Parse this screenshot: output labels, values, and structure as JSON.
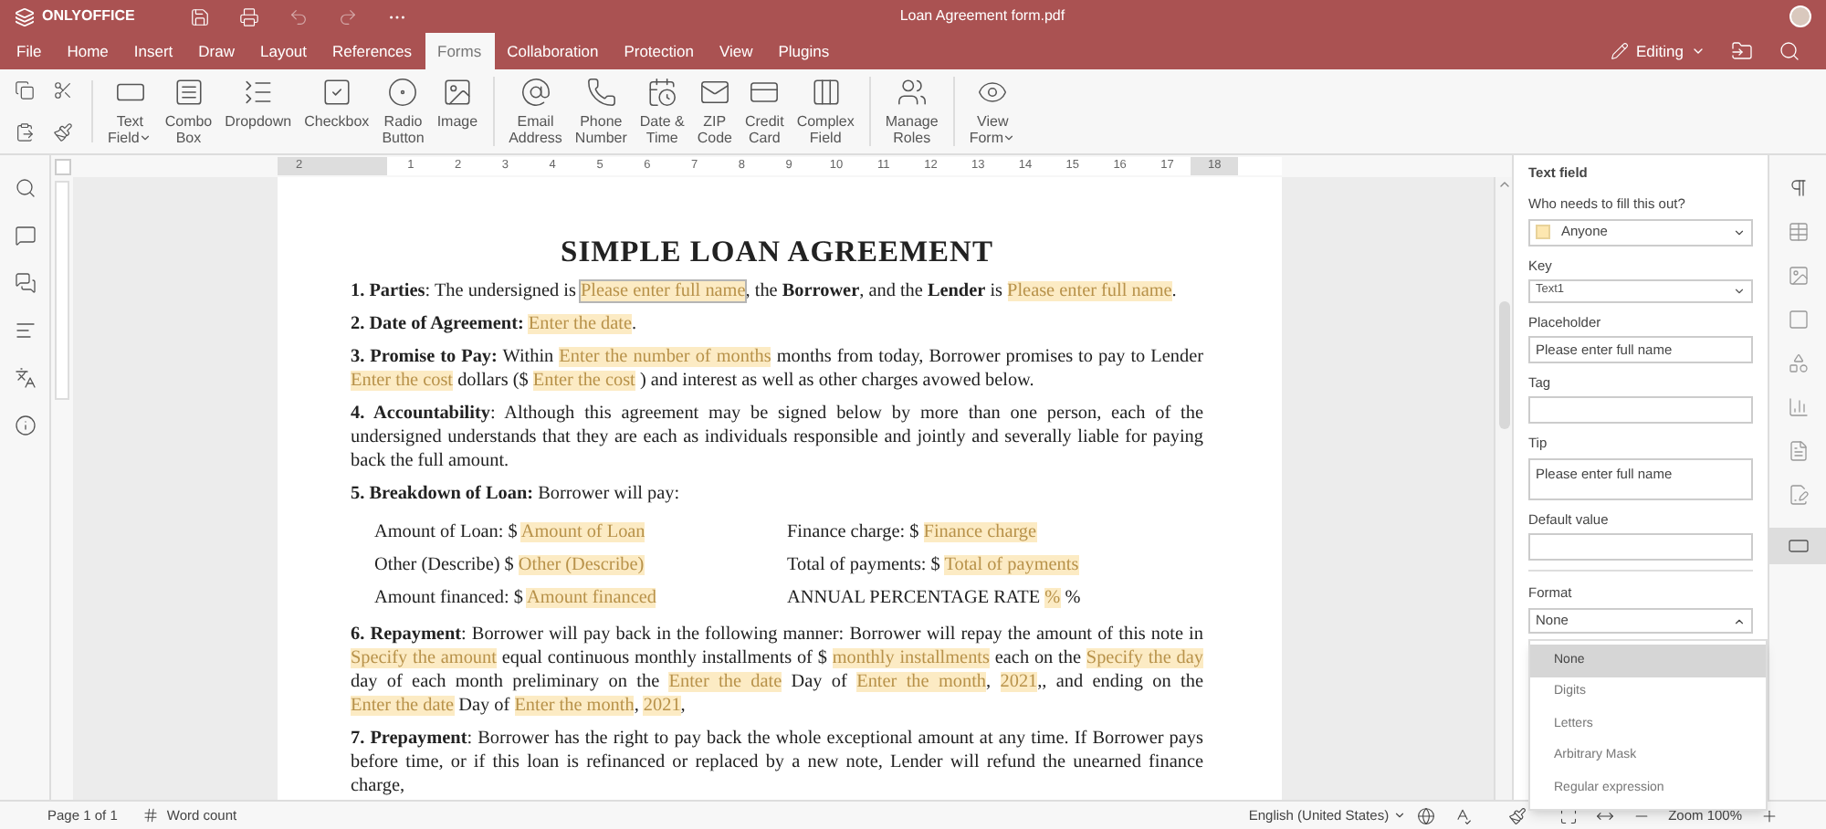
{
  "app": {
    "logo": "ONLYOFFICE",
    "title": "Loan Agreement form.pdf",
    "mode": "Editing"
  },
  "menu": [
    {
      "label": "File",
      "selected": false
    },
    {
      "label": "Home",
      "selected": false
    },
    {
      "label": "Insert",
      "selected": false
    },
    {
      "label": "Draw",
      "selected": false
    },
    {
      "label": "Layout",
      "selected": false
    },
    {
      "label": "References",
      "selected": false
    },
    {
      "label": "Forms",
      "selected": true
    },
    {
      "label": "Collaboration",
      "selected": false
    },
    {
      "label": "Protection",
      "selected": false
    },
    {
      "label": "View",
      "selected": false
    },
    {
      "label": "Plugins",
      "selected": false
    }
  ],
  "toolbar": [
    [
      {
        "kind": "text_field",
        "lines": [
          "Text",
          "Field"
        ],
        "menu": true
      },
      {
        "kind": "combo_box",
        "lines": [
          "Combo",
          "Box"
        ],
        "menu": false
      },
      {
        "kind": "dropdown",
        "lines": [
          "Dropdown"
        ],
        "menu": false
      },
      {
        "kind": "checkbox",
        "lines": [
          "Checkbox"
        ],
        "menu": false
      },
      {
        "kind": "radio",
        "lines": [
          "Radio",
          "Button"
        ],
        "menu": false
      },
      {
        "kind": "image",
        "lines": [
          "Image"
        ],
        "menu": false
      }
    ],
    [
      {
        "kind": "email",
        "lines": [
          "Email",
          "Address"
        ],
        "menu": false
      },
      {
        "kind": "phone",
        "lines": [
          "Phone",
          "Number"
        ],
        "menu": false
      },
      {
        "kind": "datetime",
        "lines": [
          "Date &",
          "Time"
        ],
        "menu": false
      },
      {
        "kind": "zip",
        "lines": [
          "ZIP",
          "Code"
        ],
        "menu": false
      },
      {
        "kind": "card",
        "lines": [
          "Credit",
          "Card"
        ],
        "menu": false
      },
      {
        "kind": "complex",
        "lines": [
          "Complex",
          "Field"
        ],
        "menu": false
      }
    ],
    [
      {
        "kind": "roles",
        "lines": [
          "Manage",
          "Roles"
        ],
        "menu": false
      }
    ],
    [
      {
        "kind": "view",
        "lines": [
          "View",
          "Form"
        ],
        "menu": true
      }
    ]
  ],
  "ruler": {
    "left_label": "2",
    "labels": [
      "1",
      "2",
      "3",
      "4",
      "5",
      "6",
      "7",
      "8",
      "9",
      "10",
      "11",
      "12",
      "13",
      "14",
      "15",
      "16",
      "17",
      "18"
    ]
  },
  "document": {
    "title": "SIMPLE LOAN AGREEMENT",
    "paragraphs": [
      {
        "segments": [
          {
            "kind": "text",
            "text": "**1. Parties**: The undersigned is "
          },
          {
            "kind": "field",
            "text": "Please enter full name",
            "selected": true
          },
          {
            "kind": "text",
            "text": ", the **Borrower**, and the **Lender** is "
          },
          {
            "kind": "field",
            "text": "Please enter full name",
            "selected": false
          },
          {
            "kind": "text",
            "text": "."
          }
        ]
      },
      {
        "segments": [
          {
            "kind": "text",
            "text": "**2. Date of Agreement:** "
          },
          {
            "kind": "field",
            "text": "Enter the date",
            "selected": false
          },
          {
            "kind": "text",
            "text": "."
          }
        ]
      },
      {
        "segments": [
          {
            "kind": "text",
            "text": "**3. Promise to Pay:** Within "
          },
          {
            "kind": "field",
            "text": "Enter the number of months",
            "selected": false
          },
          {
            "kind": "text",
            "text": " months from today, Borrower promises to pay to Lender "
          },
          {
            "kind": "field",
            "text": "Enter the cost",
            "selected": false
          },
          {
            "kind": "text",
            "text": " dollars ($ "
          },
          {
            "kind": "field",
            "text": "Enter the cost",
            "selected": false
          },
          {
            "kind": "text",
            "text": " ) and interest as well as other charges avowed below."
          }
        ]
      },
      {
        "segments": [
          {
            "kind": "text",
            "text": "**4. Accountability**: Although this agreement may be signed below by more than one person, each of the undersigned understands that they are each as individuals responsible and jointly and severally liable for paying back the full amount."
          }
        ]
      },
      {
        "segments": [
          {
            "kind": "text",
            "text": "**5. Breakdown of Loan:** Borrower will pay:"
          }
        ],
        "rows": [
          {
            "left": [
              {
                "kind": "text",
                "text": "Amount of Loan: $ "
              },
              {
                "kind": "field",
                "text": "Amount of Loan",
                "selected": false
              }
            ],
            "right": [
              {
                "kind": "text",
                "text": "Finance charge: $ "
              },
              {
                "kind": "field",
                "text": "Finance charge",
                "selected": false
              }
            ]
          },
          {
            "left": [
              {
                "kind": "text",
                "text": "Other (Describe) $ "
              },
              {
                "kind": "field",
                "text": "Other (Describe)",
                "selected": false
              }
            ],
            "right": [
              {
                "kind": "text",
                "text": "Total of payments: $ "
              },
              {
                "kind": "field",
                "text": "Total of payments",
                "selected": false
              }
            ]
          },
          {
            "left": [
              {
                "kind": "text",
                "text": "Amount financed: $ "
              },
              {
                "kind": "field",
                "text": "Amount financed",
                "selected": false
              }
            ],
            "right": [
              {
                "kind": "text",
                "text": "ANNUAL PERCENTAGE RATE "
              },
              {
                "kind": "field",
                "text": "%",
                "selected": false
              },
              {
                "kind": "text",
                "text": " %"
              }
            ]
          }
        ]
      },
      {
        "segments": [
          {
            "kind": "text",
            "text": "**6. Repayment**: Borrower will pay back in the following manner: Borrower will repay the amount of this note in "
          },
          {
            "kind": "field",
            "text": "Specify the amount",
            "selected": false
          },
          {
            "kind": "text",
            "text": " equal continuous monthly installments of $ "
          },
          {
            "kind": "field",
            "text": "monthly installments",
            "selected": false
          },
          {
            "kind": "text",
            "text": " each on the "
          },
          {
            "kind": "field",
            "text": "Specify the day",
            "selected": false
          },
          {
            "kind": "text",
            "text": " day of each month preliminary on the "
          },
          {
            "kind": "field",
            "text": "Enter the date",
            "selected": false
          },
          {
            "kind": "text",
            "text": " Day of "
          },
          {
            "kind": "field",
            "text": "Enter the month",
            "selected": false
          },
          {
            "kind": "text",
            "text": ", "
          },
          {
            "kind": "field",
            "text": "2021",
            "selected": false
          },
          {
            "kind": "text",
            "text": ",, and ending on the "
          },
          {
            "kind": "field",
            "text": "Enter the date",
            "selected": false
          },
          {
            "kind": "text",
            "text": " Day of "
          },
          {
            "kind": "field",
            "text": "Enter the month",
            "selected": false
          },
          {
            "kind": "text",
            "text": ", "
          },
          {
            "kind": "field",
            "text": "2021",
            "selected": false
          },
          {
            "kind": "text",
            "text": ","
          }
        ]
      },
      {
        "segments": [
          {
            "kind": "text",
            "text": "**7. Prepayment**: Borrower has the right to pay back the whole exceptional amount at any time. If Borrower pays before time, or if this loan is refinanced or replaced by a new note, Lender will refund the unearned finance charge,"
          }
        ]
      }
    ]
  },
  "panel": {
    "title": "Text field",
    "fields": [
      {
        "kind": "role",
        "label": "Who needs to fill this out?",
        "value": "Anyone"
      },
      {
        "kind": "select",
        "label": "Key",
        "value": "Text1"
      },
      {
        "kind": "input",
        "label": "Placeholder",
        "value": "Please enter full name"
      },
      {
        "kind": "input",
        "label": "Tag"
      },
      {
        "kind": "textarea",
        "label": "Tip",
        "value": "Please enter full name"
      },
      {
        "kind": "input",
        "label": "Default value"
      }
    ],
    "format": {
      "label": "Format",
      "value": "None",
      "expanded": true,
      "options": [
        {
          "label": "None",
          "selected": true
        },
        {
          "label": "Digits",
          "selected": false
        },
        {
          "label": "Letters",
          "selected": false
        },
        {
          "label": "Arbitrary Mask",
          "selected": false
        },
        {
          "label": "Regular expression",
          "selected": false
        }
      ]
    }
  },
  "status_bar": {
    "page": "Page 1 of 1",
    "word_count": "Word count",
    "language": "English (United States)",
    "zoom": "Zoom 100%"
  }
}
